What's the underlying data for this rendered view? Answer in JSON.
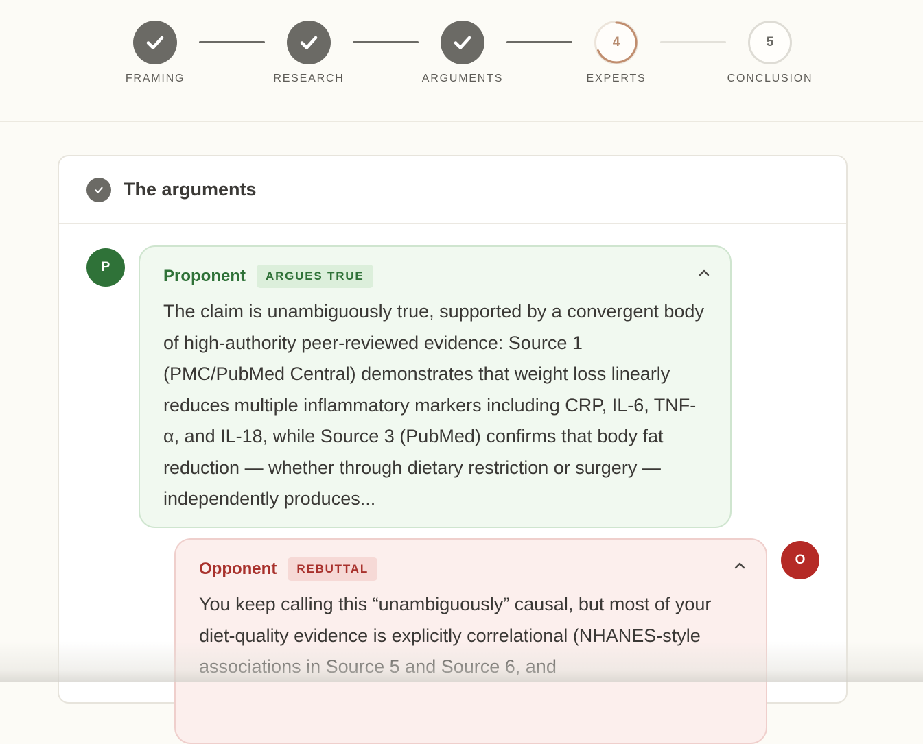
{
  "stepper": {
    "steps": [
      {
        "label": "FRAMING",
        "state": "done"
      },
      {
        "label": "RESEARCH",
        "state": "done"
      },
      {
        "label": "ARGUMENTS",
        "state": "done"
      },
      {
        "label": "EXPERTS",
        "state": "current",
        "number": "4"
      },
      {
        "label": "CONCLUSION",
        "state": "pending",
        "number": "5"
      }
    ]
  },
  "card": {
    "title": "The arguments"
  },
  "proponent": {
    "avatar_letter": "P",
    "name": "Proponent",
    "tag": "ARGUES TRUE",
    "text": "The claim is unambiguously true, supported by a convergent body of high-authority peer-reviewed evidence: Source 1 (PMC/PubMed Central) demonstrates that weight loss linearly reduces multiple inflammatory markers including CRP, IL-6, TNF-α, and IL-18, while Source 3 (PubMed) confirms that body fat reduction — whether through dietary restriction or surgery — independently produces...",
    "color": "#2f7238"
  },
  "opponent": {
    "avatar_letter": "O",
    "name": "Opponent",
    "tag": "REBUTTAL",
    "text": "You keep calling this “unambiguously” causal, but most of your diet-quality evidence is explicitly correlational (NHANES-style associations in Source 5 and Source 6, and",
    "color": "#b52a26"
  },
  "icons": {
    "done": "check-icon",
    "collapse": "chevron-up-icon"
  }
}
